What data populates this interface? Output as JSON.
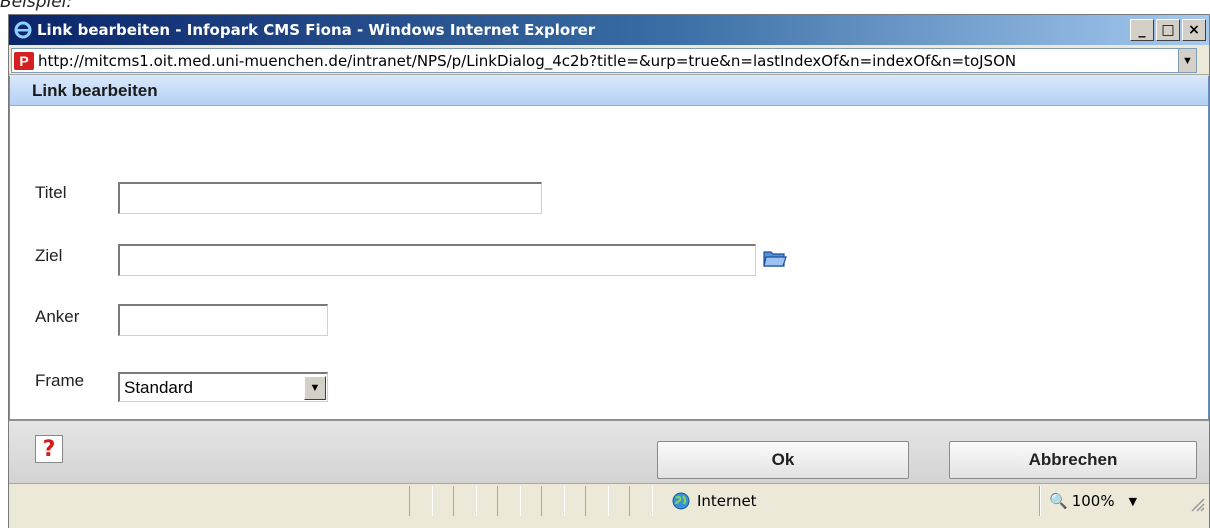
{
  "caption": "Beispiel:",
  "window": {
    "title": "Link bearbeiten - Infopark CMS Fiona - Windows Internet Explorer",
    "buttons": {
      "minimize": "_",
      "maximize": "□",
      "close": "×"
    }
  },
  "address": {
    "url": "http://mitcms1.oit.med.uni-muenchen.de/intranet/NPS/p/LinkDialog_4c2b?title=&urp=true&n=lastIndexOf&n=indexOf&n=toJSON",
    "site_icon_text": "P"
  },
  "dialog": {
    "header": "Link bearbeiten",
    "fields": {
      "titel_label": "Titel",
      "titel_value": "",
      "ziel_label": "Ziel",
      "ziel_value": "",
      "anker_label": "Anker",
      "anker_value": "",
      "frame_label": "Frame",
      "frame_value": "Standard"
    },
    "help_glyph": "?",
    "ok_label": "Ok",
    "cancel_label": "Abbrechen"
  },
  "statusbar": {
    "zone": "Internet",
    "zoom": "100%"
  },
  "colors": {
    "titlebar_start": "#0a246a",
    "dialog_header": "#b5d1f5",
    "help_red": "#d41c1c"
  }
}
